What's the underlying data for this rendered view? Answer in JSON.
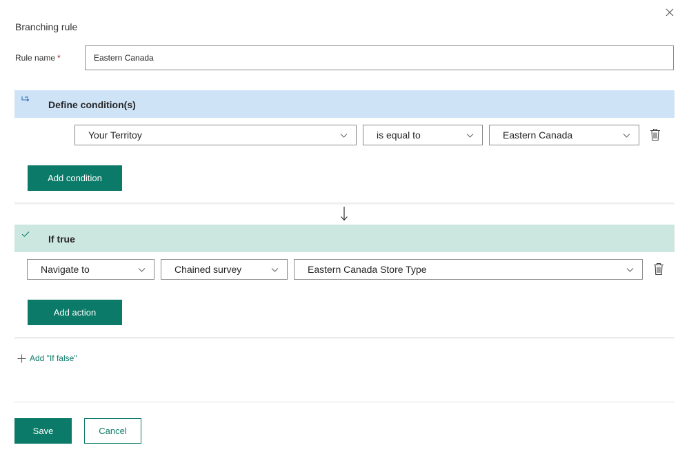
{
  "dialog": {
    "title": "Branching rule",
    "close_icon": "close-icon"
  },
  "rule_name": {
    "label": "Rule name",
    "required_mark": "*",
    "value": "Eastern Canada"
  },
  "condition_section": {
    "title": "Define condition(s)",
    "icon": "branch-icon",
    "condition": {
      "field": "Your Territoy",
      "operator": "is equal to",
      "value": "Eastern Canada"
    },
    "add_condition_label": "Add condition"
  },
  "true_section": {
    "title": "If true",
    "icon": "check-icon",
    "action": {
      "type": "Navigate to",
      "target_type": "Chained survey",
      "target": "Eastern Canada Store Type"
    },
    "add_action_label": "Add action"
  },
  "add_if_false_label": "Add \"If false\"",
  "footer": {
    "save_label": "Save",
    "cancel_label": "Cancel"
  },
  "colors": {
    "accent": "#0b7a68",
    "condition_header_bg": "#cfe3f7",
    "true_header_bg": "#cce6e0"
  }
}
